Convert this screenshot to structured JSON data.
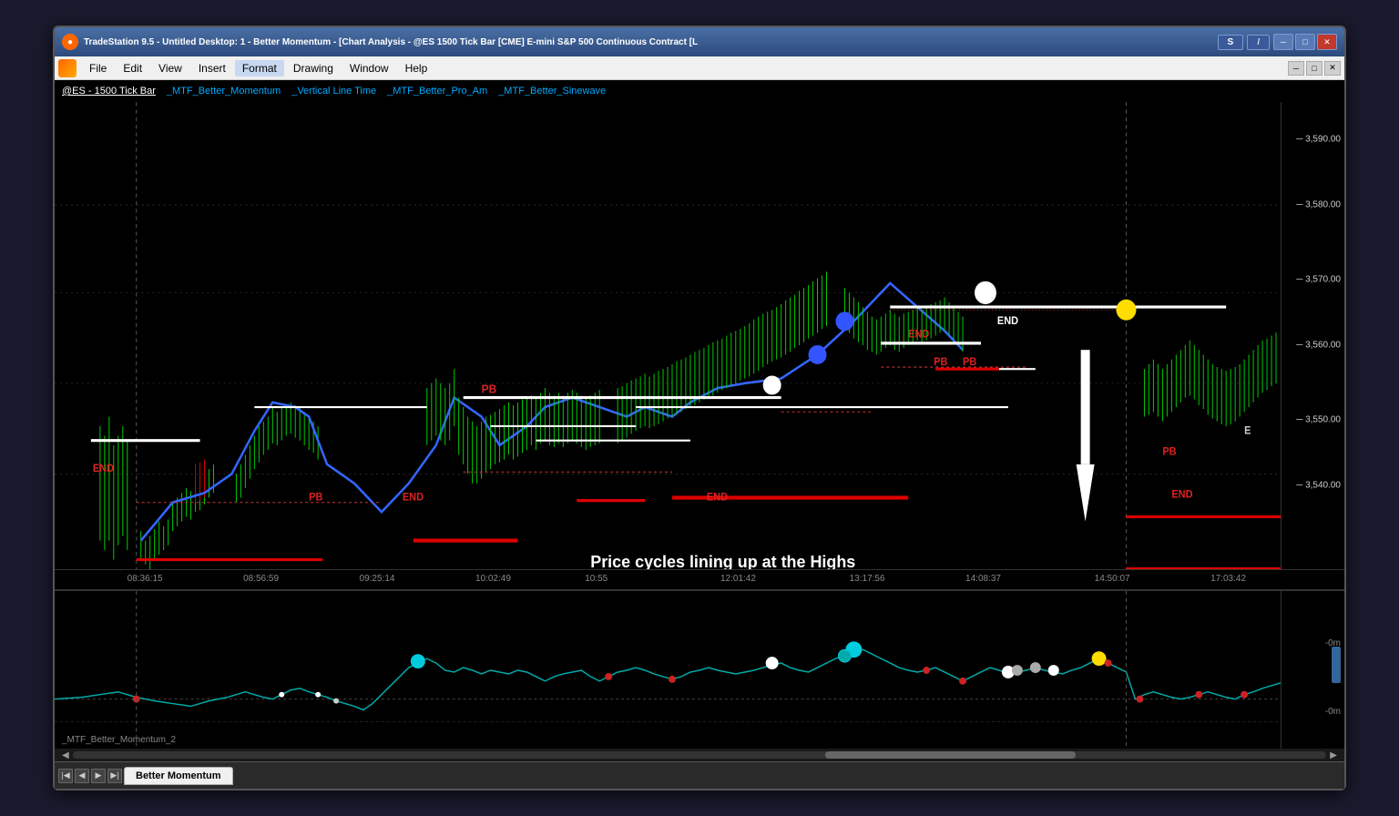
{
  "title_bar": {
    "icon": "●",
    "text": "TradeStation 9.5 - Untitled Desktop: 1 - Better Momentum - [Chart Analysis - @ES 1500 Tick Bar [CME] E-mini S&P 500 Continuous Contract [L",
    "btn_s": "S",
    "btn_i": "I",
    "wc_min": "─",
    "wc_max": "□",
    "wc_close": "✕"
  },
  "menu": {
    "icon_text": "🔧",
    "items": [
      "File",
      "Edit",
      "View",
      "Insert",
      "Format",
      "Drawing",
      "Window",
      "Help"
    ]
  },
  "chart_header": {
    "items": [
      "@ES - 1500 Tick Bar",
      "_MTF_Better_Momentum",
      "_Vertical Line Time",
      "_MTF_Better_Pro_Am",
      "_MTF_Better_Sinewave"
    ]
  },
  "price_labels": [
    {
      "value": "3,590.00",
      "pct": 8
    },
    {
      "value": "3,580.00",
      "pct": 22
    },
    {
      "value": "3,570.00",
      "pct": 38
    },
    {
      "value": "3,560.00",
      "pct": 52
    },
    {
      "value": "3,550.00",
      "pct": 68
    },
    {
      "value": "3,540.00",
      "pct": 82
    }
  ],
  "time_labels": [
    {
      "time": "08:36:15",
      "pct": 7
    },
    {
      "time": "08:56:59",
      "pct": 16
    },
    {
      "time": "09:25:14",
      "pct": 25
    },
    {
      "time": "10:02:49",
      "pct": 34
    },
    {
      "time": "10:55",
      "pct": 42
    },
    {
      "time": "12:01:42",
      "pct": 53
    },
    {
      "time": "13:17:56",
      "pct": 63
    },
    {
      "time": "14:08:37",
      "pct": 72
    },
    {
      "time": "14:50:07",
      "pct": 82
    },
    {
      "time": "17:03:42",
      "pct": 92
    }
  ],
  "annotation": {
    "text": "Price cycles lining up at the Highs",
    "color": "#ffffff"
  },
  "chart_labels": {
    "bottom_label": "_MTF_Better_Momentum_2",
    "edge_label": "E"
  },
  "osc_labels": {
    "labels": [
      "-0m",
      "-0m"
    ]
  },
  "tab": {
    "label": "Better Momentum"
  },
  "pb_labels": [
    {
      "text": "PB",
      "color": "#ff3333"
    },
    {
      "text": "END",
      "color": "#ff3333"
    }
  ]
}
